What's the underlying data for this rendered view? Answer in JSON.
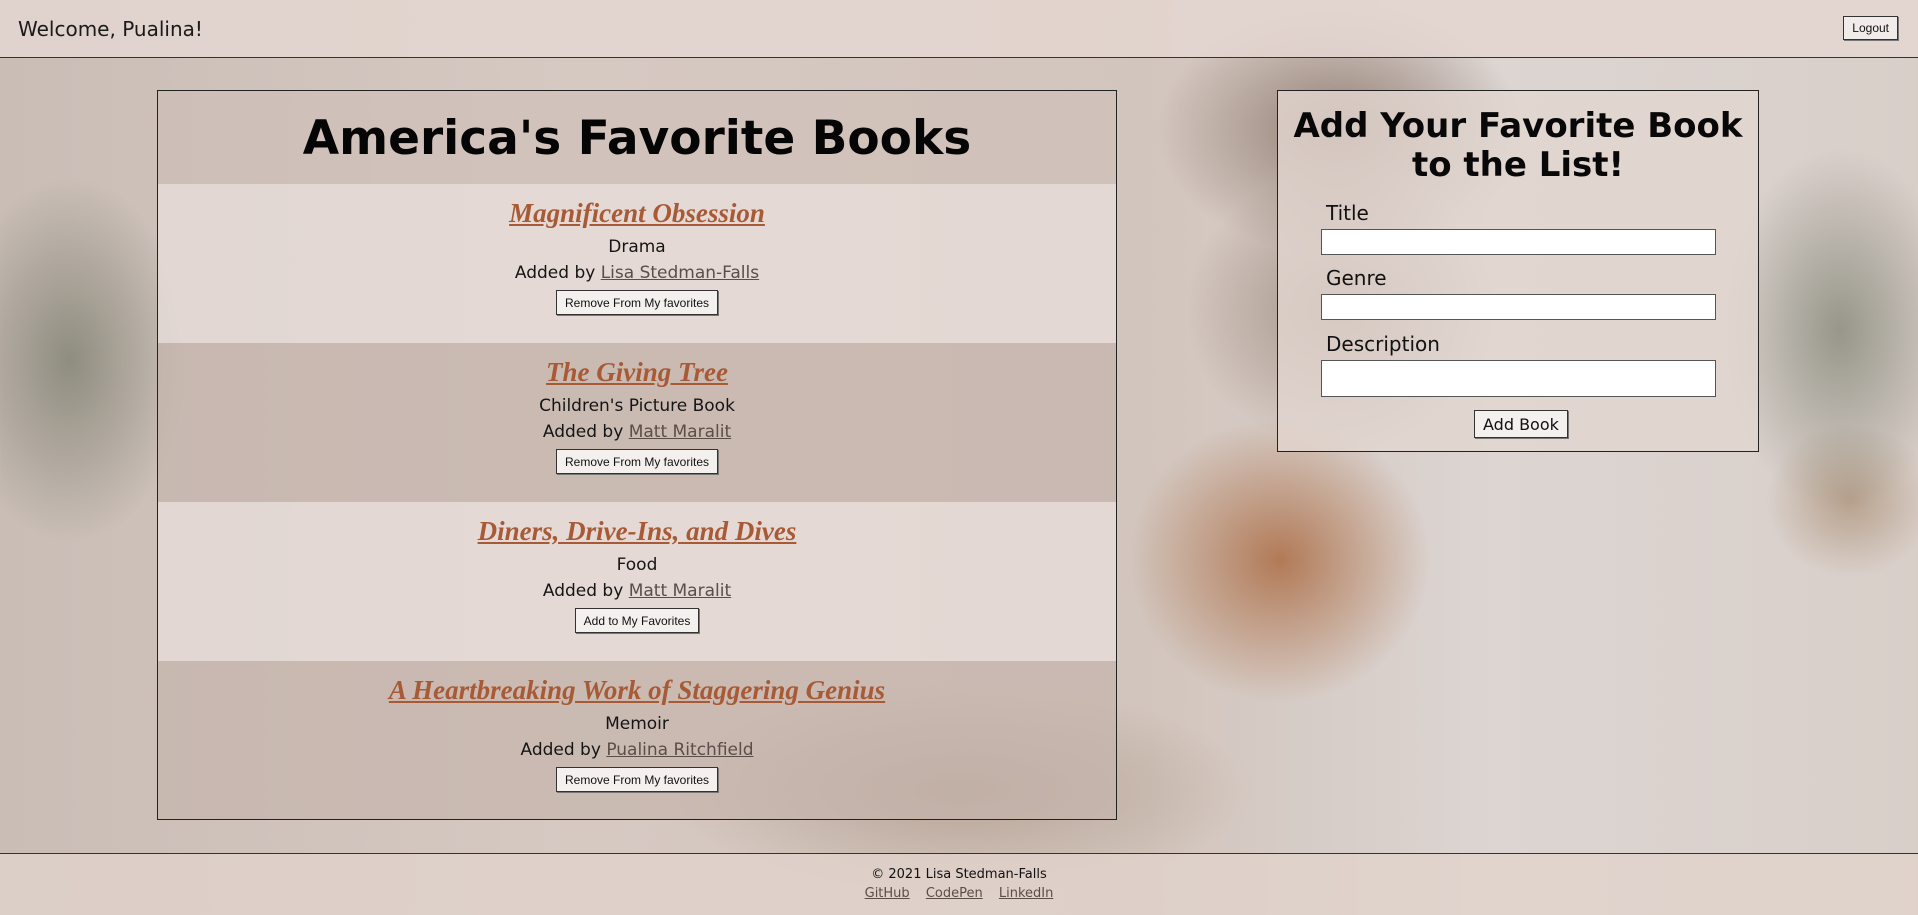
{
  "header": {
    "welcome": "Welcome, Pualina!",
    "logout_label": "Logout"
  },
  "books_section": {
    "title": "America's Favorite Books",
    "added_by_prefix": "Added by",
    "books": [
      {
        "title": "Magnificent Obsession",
        "genre": "Drama",
        "added_by": "Lisa Stedman-Falls",
        "action_label": "Remove From My favorites"
      },
      {
        "title": "The Giving Tree",
        "genre": "Children's Picture Book",
        "added_by": "Matt Maralit",
        "action_label": "Remove From My favorites"
      },
      {
        "title": "Diners, Drive-Ins, and Dives",
        "genre": "Food",
        "added_by": "Matt Maralit",
        "action_label": "Add to My Favorites"
      },
      {
        "title": "A Heartbreaking Work of Staggering Genius",
        "genre": "Memoir",
        "added_by": "Pualina Ritchfield",
        "action_label": "Remove From My favorites"
      }
    ]
  },
  "add_form": {
    "title": "Add Your Favorite Book to the List!",
    "title_label": "Title",
    "genre_label": "Genre",
    "description_label": "Description",
    "title_value": "",
    "genre_value": "",
    "description_value": "",
    "submit_label": "Add Book"
  },
  "footer": {
    "copyright": "© 2021 Lisa Stedman-Falls",
    "links": [
      "GitHub",
      "CodePen",
      "LinkedIn"
    ]
  },
  "colors": {
    "book_title": "#a75a35",
    "link": "#5b4d47"
  }
}
